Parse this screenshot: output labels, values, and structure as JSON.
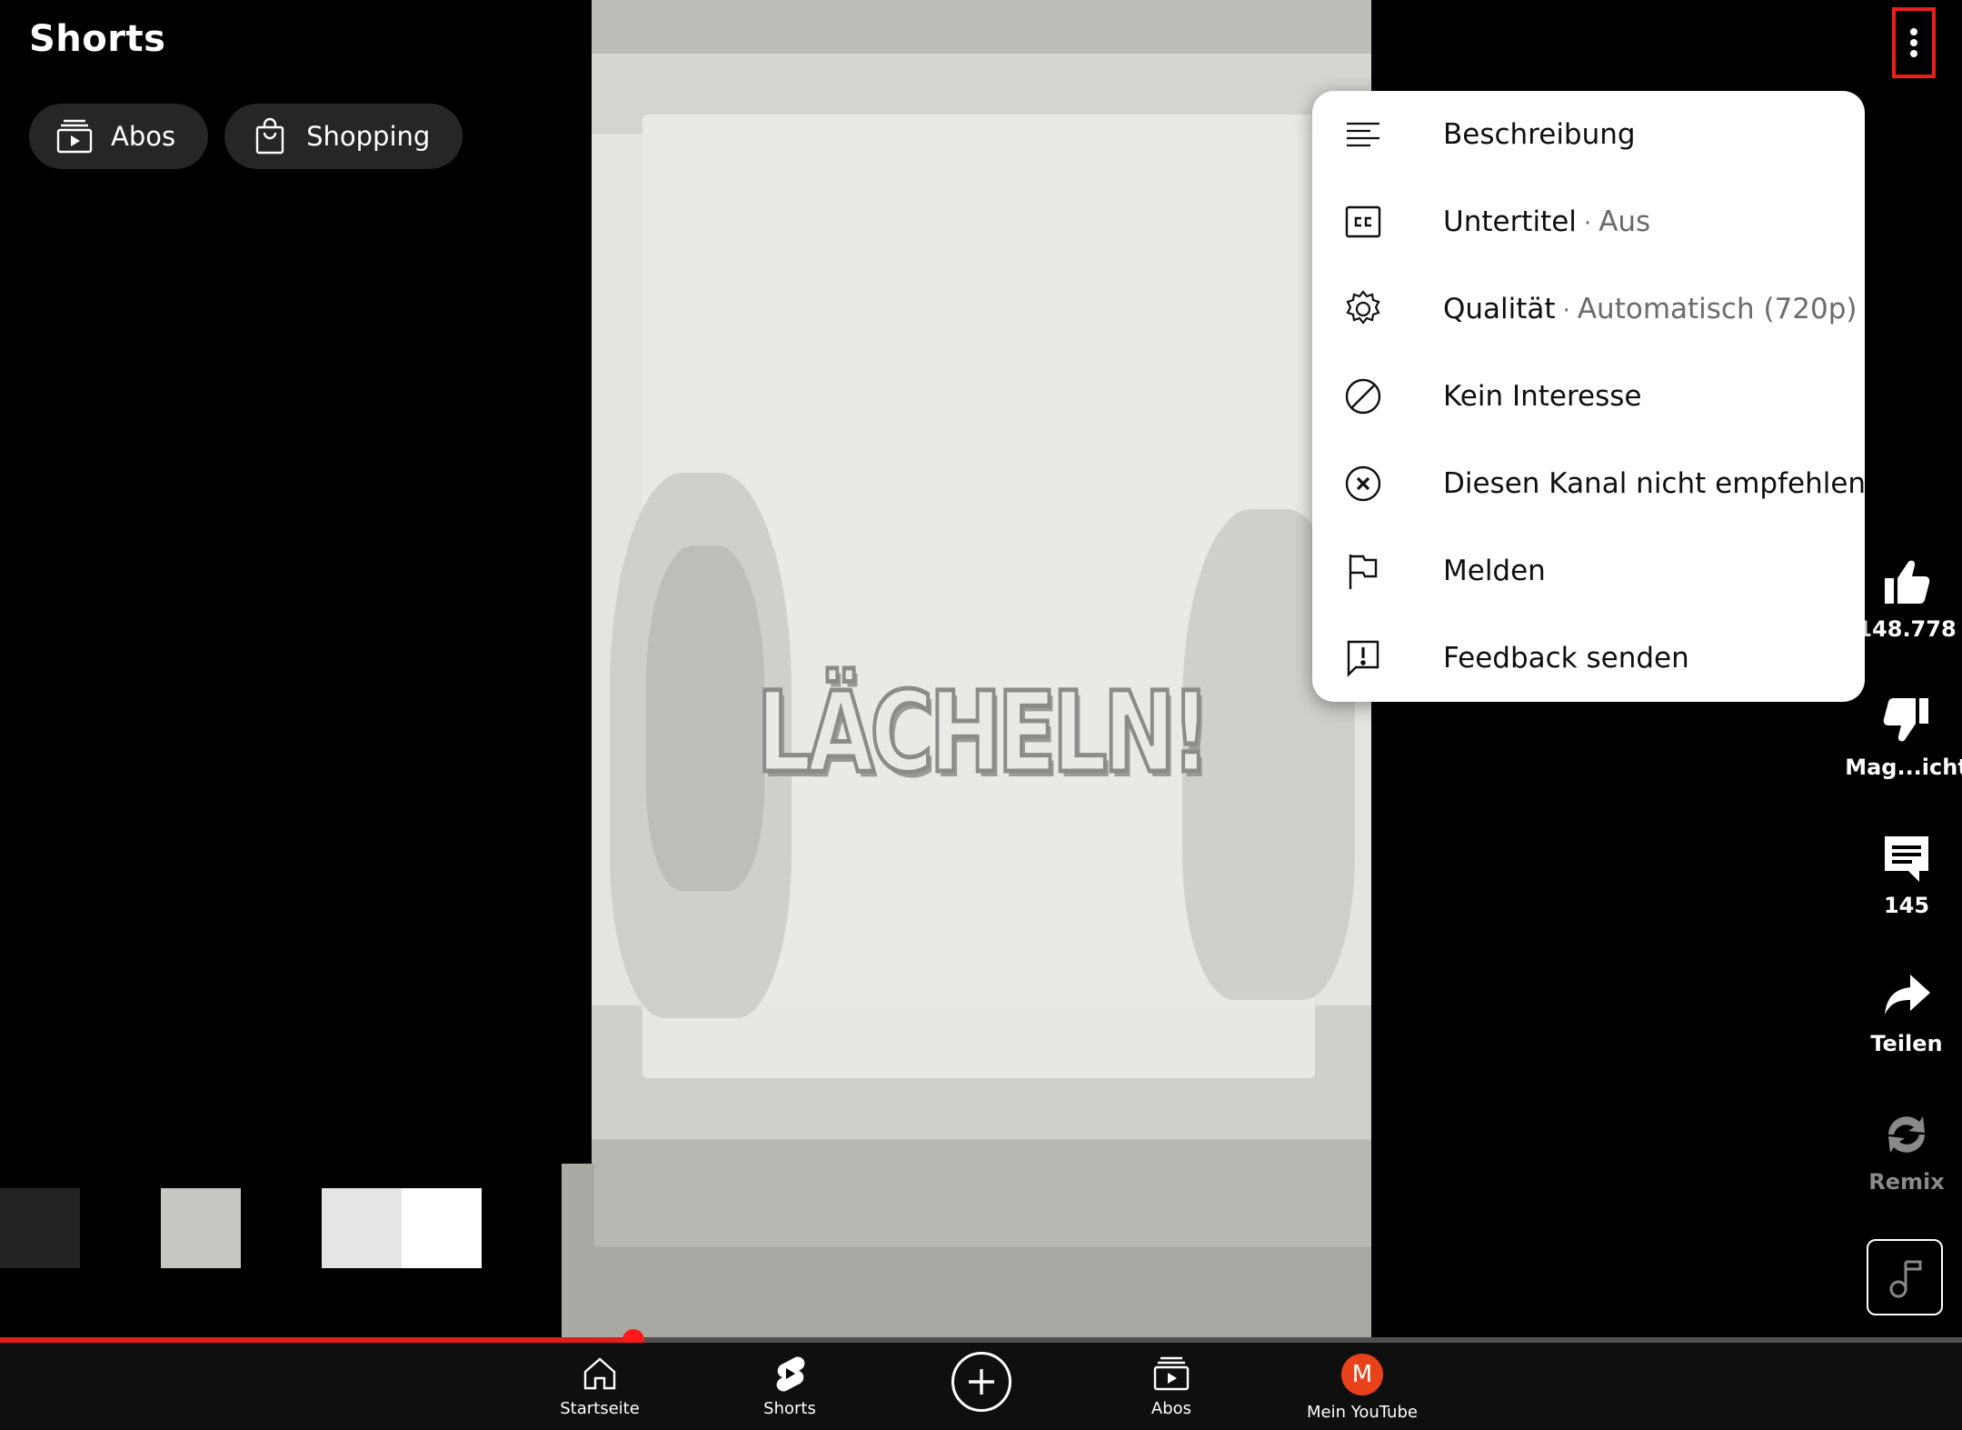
{
  "header": {
    "title": "Shorts",
    "chips": [
      {
        "label": "Abos",
        "icon": "subscriptions-icon"
      },
      {
        "label": "Shopping",
        "icon": "shopping-bag-icon"
      }
    ]
  },
  "video": {
    "caption": "LÄCHELN!",
    "progress_fraction": 0.323
  },
  "overflow_button": {
    "icon": "more-vert-icon",
    "highlight_color": "#ea1f1f"
  },
  "menu": {
    "items": [
      {
        "label": "Beschreibung",
        "icon": "description-icon"
      },
      {
        "label": "Untertitel",
        "sub": "Aus",
        "icon": "closed-captions-icon"
      },
      {
        "label": "Qualität",
        "sub": "Automatisch (720p)",
        "icon": "settings-gear-icon"
      },
      {
        "label": "Kein Interesse",
        "icon": "not-interested-icon"
      },
      {
        "label": "Diesen Kanal nicht empfehlen",
        "icon": "circle-x-icon"
      },
      {
        "label": "Melden",
        "icon": "flag-icon"
      },
      {
        "label": "Feedback senden",
        "icon": "feedback-icon"
      }
    ]
  },
  "actions": {
    "like": {
      "label": "148.778",
      "icon": "thumbs-up-icon"
    },
    "dislike": {
      "label": "Mag...icht",
      "icon": "thumbs-down-icon"
    },
    "comments": {
      "label": "145",
      "icon": "comment-icon"
    },
    "share": {
      "label": "Teilen",
      "icon": "share-icon"
    },
    "remix": {
      "label": "Remix",
      "icon": "remix-icon"
    },
    "sound": {
      "icon": "music-note-icon"
    }
  },
  "bottom_nav": {
    "items": [
      {
        "label": "Startseite",
        "icon": "home-icon"
      },
      {
        "label": "Shorts",
        "icon": "shorts-icon"
      },
      {
        "label": "",
        "icon": "create-plus-icon"
      },
      {
        "label": "Abos",
        "icon": "subscriptions-icon"
      },
      {
        "label": "Mein YouTube",
        "icon": "avatar",
        "avatar_letter": "M"
      }
    ]
  },
  "colors": {
    "progress": "#e01e1e",
    "avatar": "#e8421c",
    "menu_bg": "#ffffff",
    "background": "#000000"
  }
}
